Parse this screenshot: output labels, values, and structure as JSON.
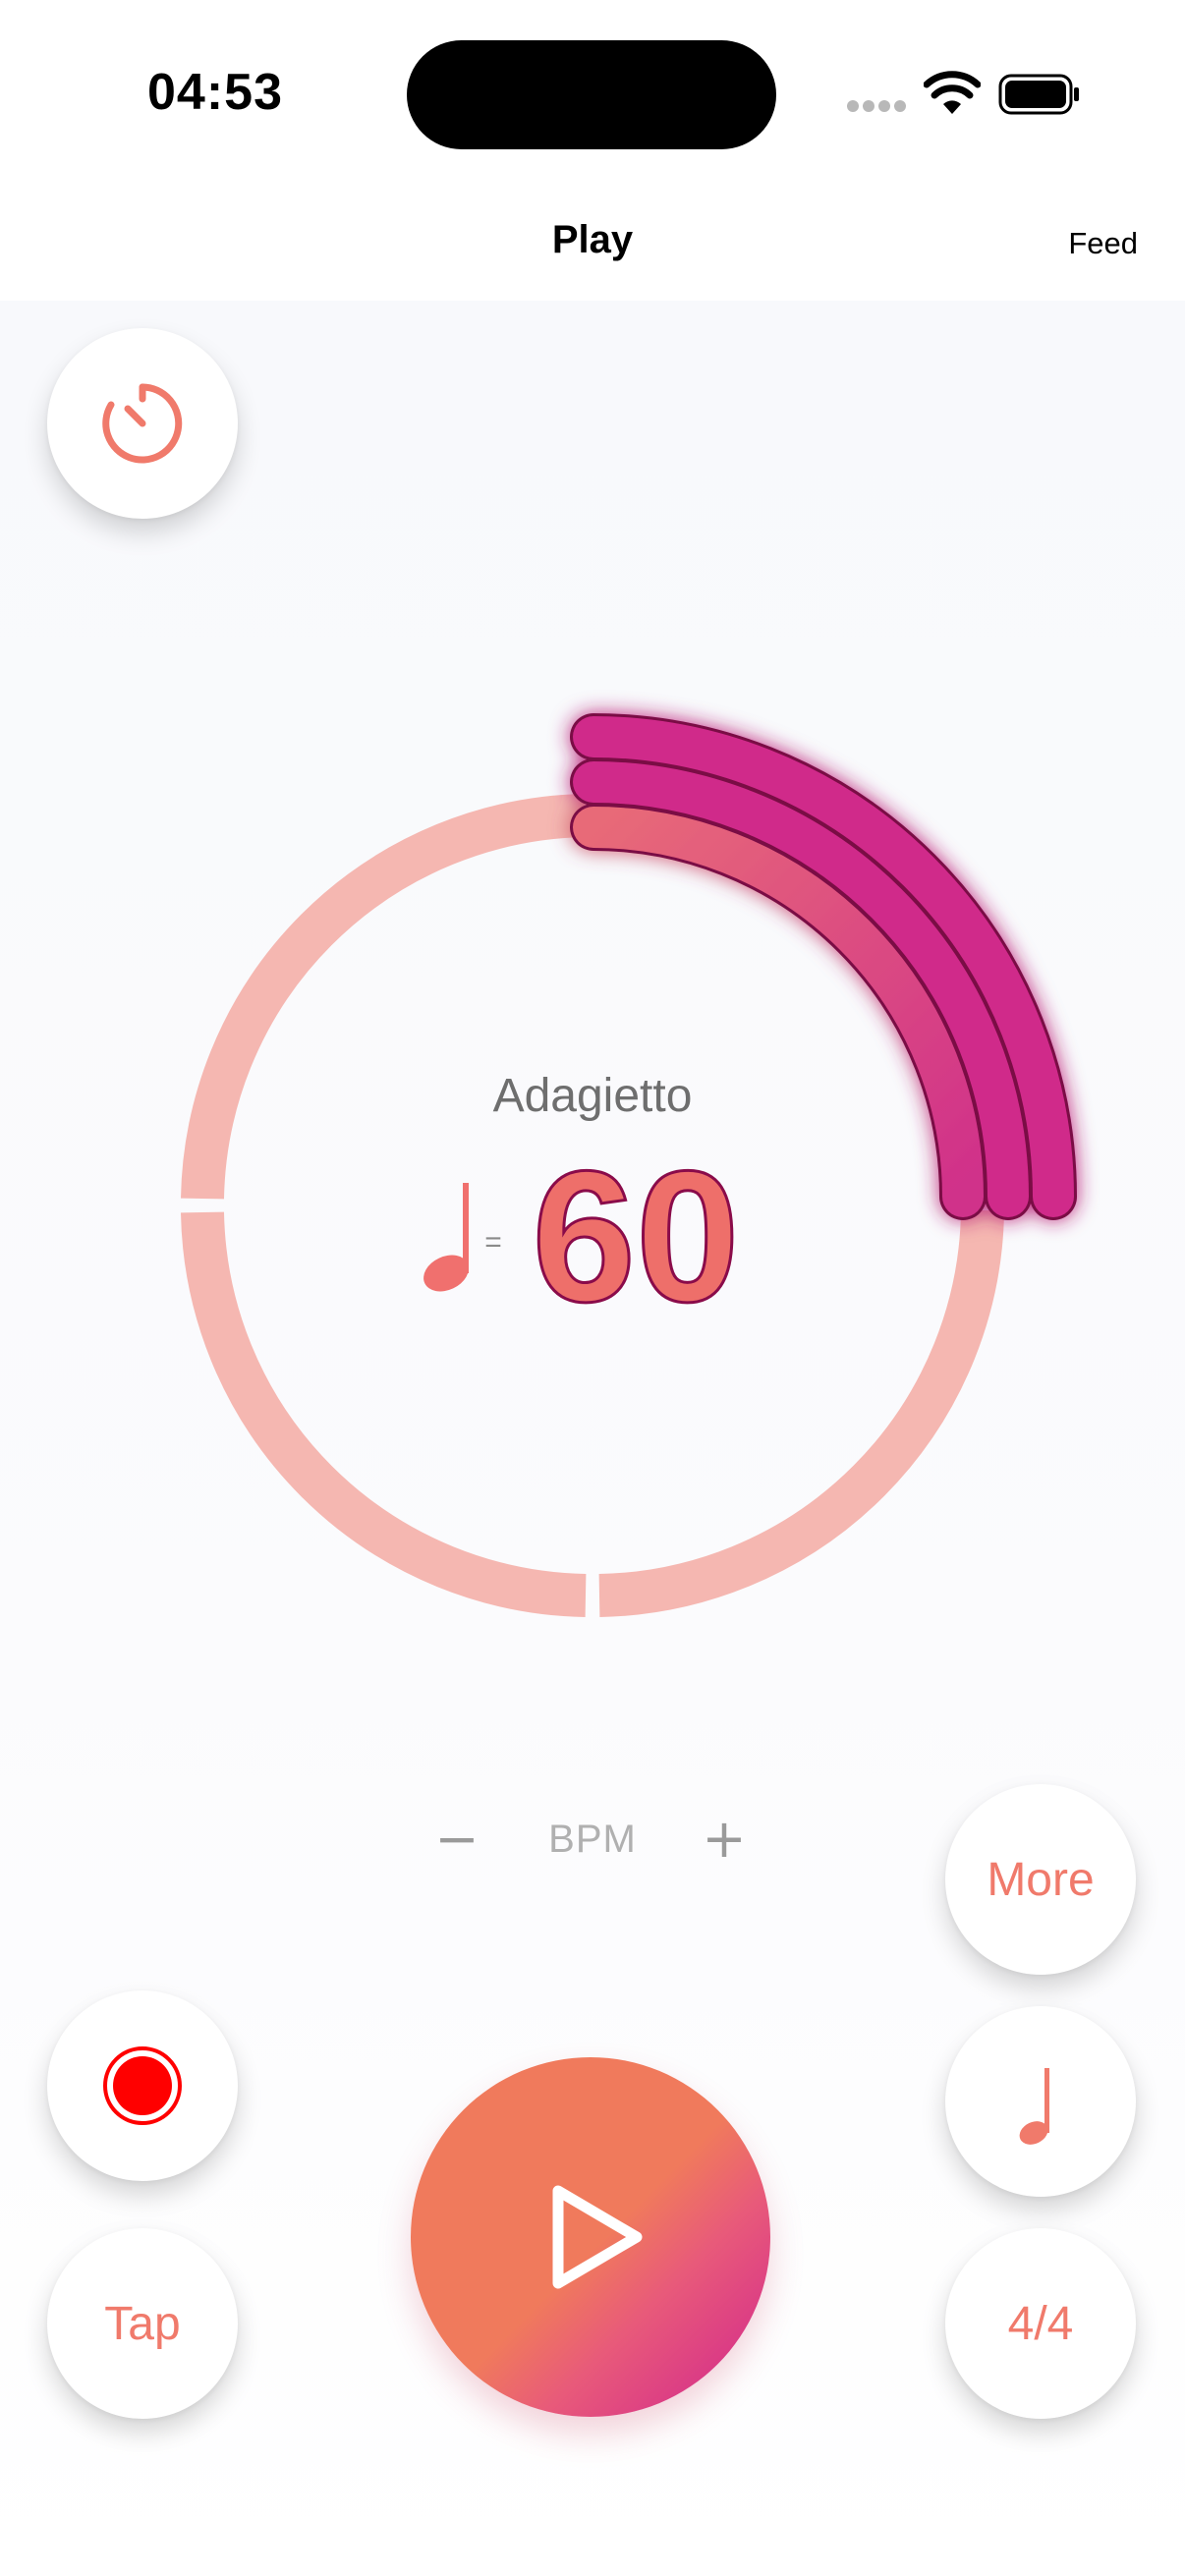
{
  "status_bar": {
    "time": "04:53"
  },
  "nav": {
    "title": "Play",
    "feed_label": "Feed"
  },
  "metronome": {
    "tempo_name": "Adagietto",
    "equals": "=",
    "bpm": "60"
  },
  "bpm_control": {
    "label": "BPM",
    "minus": "−",
    "plus": "+"
  },
  "buttons": {
    "more_label": "More",
    "tap_label": "Tap",
    "time_signature": "4/4"
  },
  "icons": {
    "timer": "timer-icon",
    "record": "record-icon",
    "note": "quarter-note-icon",
    "play": "play-icon",
    "wifi": "wifi-icon",
    "battery": "battery-icon",
    "signal": "cellular-signal-icon"
  },
  "colors": {
    "accent": "#f07a6b",
    "ring_track": "#f5b7b1",
    "beat_arc": "#d02a8a",
    "record": "#ff0000",
    "play_gradient_start": "#f07a5c",
    "play_gradient_end": "#d0228e"
  }
}
